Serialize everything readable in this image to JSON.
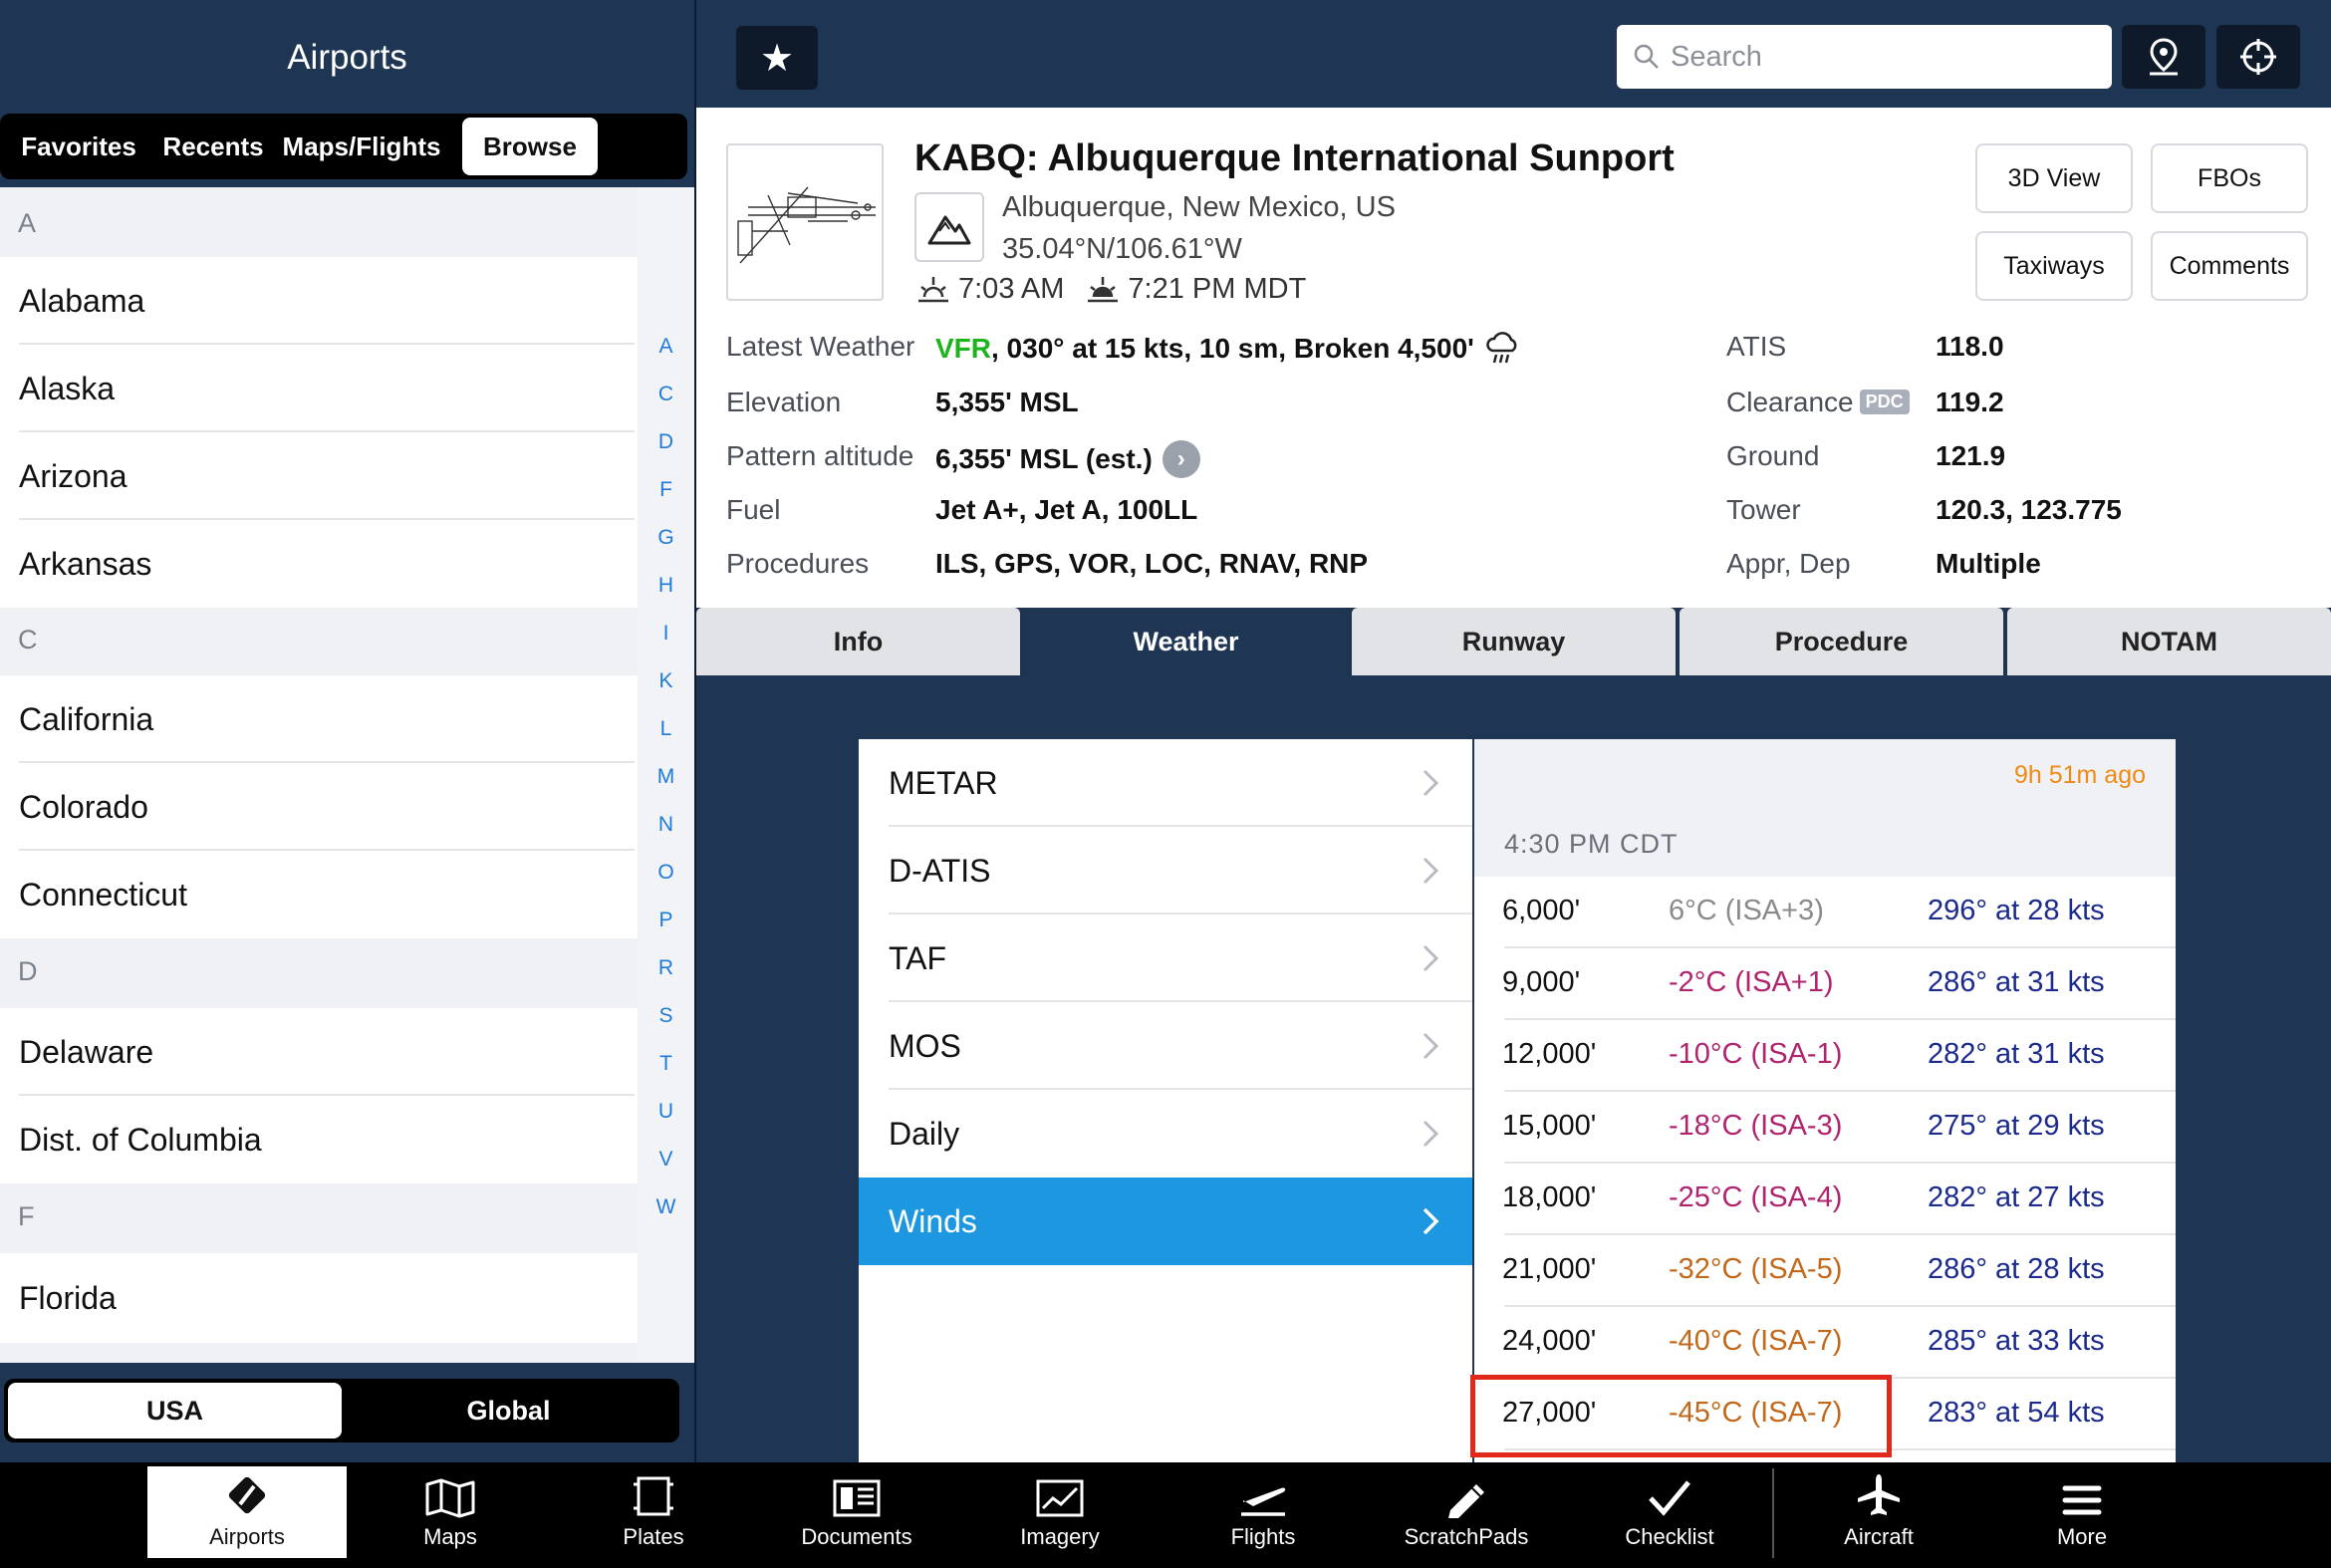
{
  "left_panel": {
    "title": "Airports",
    "top_segments": [
      "Favorites",
      "Recents",
      "Maps/Flights",
      "Browse"
    ],
    "active_segment": "Browse",
    "sections": [
      {
        "letter": "A",
        "states": [
          "Alabama",
          "Alaska",
          "Arizona",
          "Arkansas"
        ]
      },
      {
        "letter": "C",
        "states": [
          "California",
          "Colorado",
          "Connecticut"
        ]
      },
      {
        "letter": "D",
        "states": [
          "Delaware",
          "Dist. of Columbia"
        ]
      },
      {
        "letter": "F",
        "states": [
          "Florida"
        ]
      }
    ],
    "index_letters": [
      "A",
      "C",
      "D",
      "F",
      "G",
      "H",
      "I",
      "K",
      "L",
      "M",
      "N",
      "O",
      "P",
      "R",
      "S",
      "T",
      "U",
      "V",
      "W"
    ],
    "bottom_segments": [
      "USA",
      "Global"
    ],
    "active_bottom_segment": "USA"
  },
  "topbar": {
    "search_placeholder": "Search"
  },
  "airport": {
    "name": "KABQ: Albuquerque International Sunport",
    "city": "Albuquerque, New Mexico, US",
    "coords": "35.04°N/106.61°W",
    "sunrise": "7:03 AM",
    "sunset": "7:21 PM MDT",
    "buttons": {
      "view3d": "3D View",
      "fbos": "FBOs",
      "taxiways": "Taxiways",
      "comments": "Comments"
    },
    "left_info": [
      {
        "label": "Latest Weather",
        "flight_rules": "VFR",
        "value": ", 030° at 15 kts, 10 sm, Broken 4,500'"
      },
      {
        "label": "Elevation",
        "value": "5,355' MSL"
      },
      {
        "label": "Pattern altitude",
        "value": "6,355' MSL (est.)"
      },
      {
        "label": "Fuel",
        "value": "Jet A+, Jet A, 100LL"
      },
      {
        "label": "Procedures",
        "value": "ILS, GPS, VOR, LOC, RNAV, RNP"
      }
    ],
    "right_info": [
      {
        "label": "ATIS",
        "value": "118.0"
      },
      {
        "label": "Clearance",
        "badge": "PDC",
        "value": "119.2"
      },
      {
        "label": "Ground",
        "value": "121.9"
      },
      {
        "label": "Tower",
        "value": "120.3, 123.775"
      },
      {
        "label": "Appr, Dep",
        "value": "Multiple"
      }
    ]
  },
  "tabs": [
    "Info",
    "Weather",
    "Runway",
    "Procedure",
    "NOTAM"
  ],
  "active_tab": "Weather",
  "weather_menu": [
    "METAR",
    "D-ATIS",
    "TAF",
    "MOS",
    "Daily",
    "Winds"
  ],
  "active_weather_item": "Winds",
  "winds": {
    "age": "9h 51m ago",
    "time": "4:30 PM CDT",
    "rows": [
      {
        "alt": "6,000'",
        "temp": "6°C (ISA+3)",
        "wind": "296° at 28 kts",
        "color": "#8a8a8a"
      },
      {
        "alt": "9,000'",
        "temp": "-2°C (ISA+1)",
        "wind": "286° at 31 kts",
        "color": "#b0246e"
      },
      {
        "alt": "12,000'",
        "temp": "-10°C (ISA-1)",
        "wind": "282° at 31 kts",
        "color": "#b0246e"
      },
      {
        "alt": "15,000'",
        "temp": "-18°C (ISA-3)",
        "wind": "275° at 29 kts",
        "color": "#b0246e"
      },
      {
        "alt": "18,000'",
        "temp": "-25°C (ISA-4)",
        "wind": "282° at 27 kts",
        "color": "#b0246e"
      },
      {
        "alt": "21,000'",
        "temp": "-32°C (ISA-5)",
        "wind": "286° at 28 kts",
        "color": "#c2681b"
      },
      {
        "alt": "24,000'",
        "temp": "-40°C (ISA-7)",
        "wind": "285° at 33 kts",
        "color": "#c2681b"
      },
      {
        "alt": "27,000'",
        "temp": "-45°C (ISA-7)",
        "wind": "283° at 54 kts",
        "color": "#c2681b"
      }
    ]
  },
  "tabbar": [
    "Airports",
    "Maps",
    "Plates",
    "Documents",
    "Imagery",
    "Flights",
    "ScratchPads",
    "Checklist",
    "Aircraft",
    "More"
  ],
  "active_tabbar": "Airports"
}
